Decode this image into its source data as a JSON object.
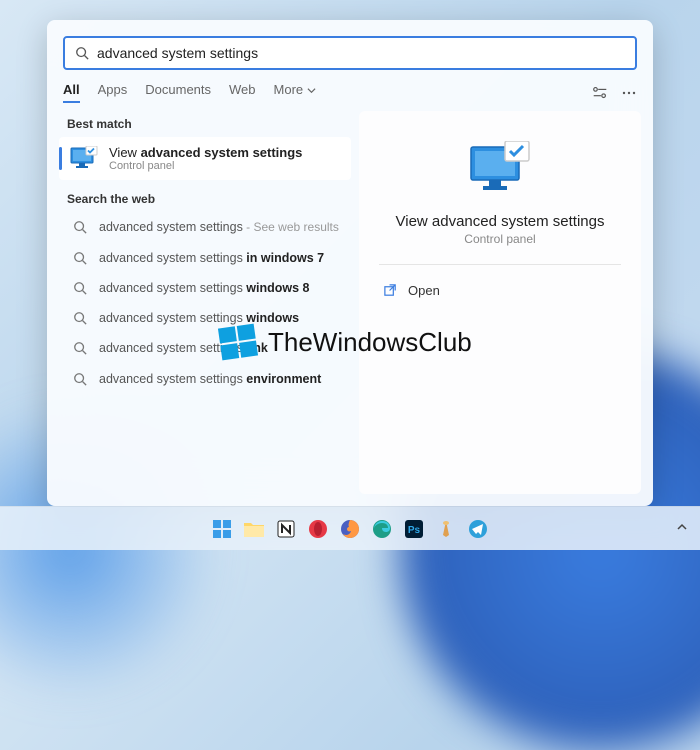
{
  "search": {
    "query": "advanced system settings"
  },
  "tabs": {
    "all": "All",
    "apps": "Apps",
    "documents": "Documents",
    "web": "Web",
    "more": "More"
  },
  "sections": {
    "best_match": "Best match",
    "search_web": "Search the web"
  },
  "best_match": {
    "prefix": "View ",
    "bold": "advanced system settings",
    "sub": "Control panel"
  },
  "web_results": [
    {
      "text": "advanced system settings",
      "hint": " - See web results"
    },
    {
      "text": "advanced system settings ",
      "bold": "in windows 7"
    },
    {
      "text": "advanced system settings ",
      "bold": "windows 8"
    },
    {
      "text": "advanced system settings ",
      "bold": "windows"
    },
    {
      "text": "advanced system settings ",
      "bold": "link"
    },
    {
      "text": "advanced system settings ",
      "bold": "environment"
    }
  ],
  "preview": {
    "title": "View advanced system settings",
    "sub": "Control panel",
    "open": "Open"
  },
  "watermark": "TheWindowsClub"
}
